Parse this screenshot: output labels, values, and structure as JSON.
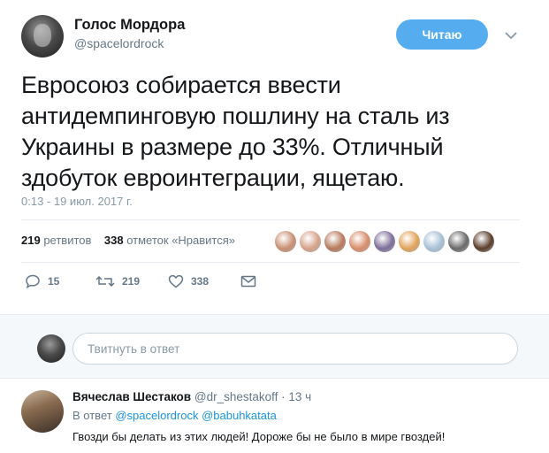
{
  "tweet": {
    "author_name": "Голос Мордора",
    "author_handle": "@spacelordrock",
    "follow_label": "Читаю",
    "text": "Евросоюз собирается ввести антидемпинговую пошлину на сталь из Украины в размере до 33%. Отличный здобуток евроинтеграции, ящетаю.",
    "timestamp": "0:13 - 19 июл. 2017 г.",
    "retweets_count": "219",
    "retweets_label": "ретвитов",
    "likes_count": "338",
    "likes_label": "отметок «Нравится»",
    "liker_avatar_colors": [
      "#c98f73",
      "#d6a28a",
      "#b77a5c",
      "#d88c6a",
      "#7d6f99",
      "#e0a35a",
      "#a8c0d6",
      "#6a6a6a",
      "#5a3d2b"
    ]
  },
  "actions": {
    "reply_count": "15",
    "retweet_count": "219",
    "like_count": "338"
  },
  "reply_box": {
    "placeholder": "Твитнуть в ответ"
  },
  "reply": {
    "author_name": "Вячеслав Шестаков",
    "author_handle": "@dr_shestakoff",
    "time": "13 ч",
    "replying_prefix": "В ответ",
    "mention_1": "@spacelordrock",
    "mention_2": "@babuhkatata",
    "text": "Гвозди бы делать из этих людей!  Дороже бы не было в мире гвоздей!"
  },
  "colors": {
    "accent": "#55acee",
    "link": "#1b95e0",
    "secondary_text": "#657786"
  }
}
